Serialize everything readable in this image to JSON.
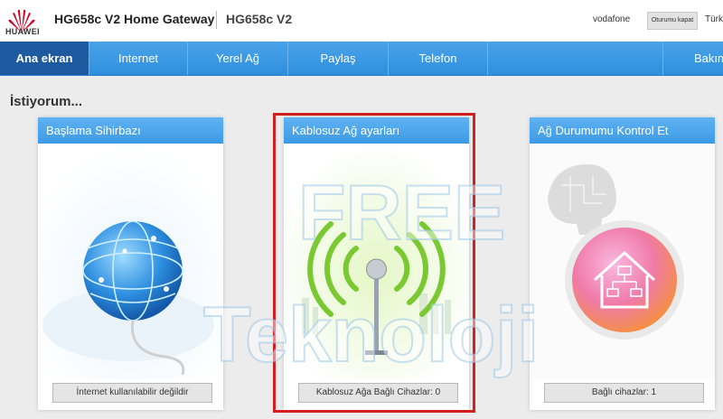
{
  "header": {
    "logo_text": "HUAWEI",
    "product_title": "HG658c V2 Home Gateway",
    "model": "HG658c V2",
    "user": "vodafone",
    "logout_label": "Oturumu kapat",
    "language": "Türkçe"
  },
  "nav": {
    "tabs": [
      {
        "label": "Ana ekran",
        "active": true
      },
      {
        "label": "Internet"
      },
      {
        "label": "Yerel Ağ"
      },
      {
        "label": "Paylaş"
      },
      {
        "label": "Telefon"
      },
      {
        "label": "Bakım"
      }
    ]
  },
  "main": {
    "heading": "İstiyorum...",
    "cards": [
      {
        "title": "Başlama Sihirbazı",
        "status": "İnternet kullanılabilir değildir",
        "icon": "globe-icon"
      },
      {
        "title": "Kablosuz Ağ ayarları",
        "status": "Kablosuz Ağa Bağlı Cihazlar: 0",
        "icon": "wifi-antenna-icon"
      },
      {
        "title": "Ağ Durumumu Kontrol Et",
        "status": "Bağlı cihazlar: 1",
        "icon": "home-network-icon"
      }
    ]
  },
  "watermark": {
    "line1": "FREE",
    "line2": "Teknoloji"
  },
  "colors": {
    "nav": "#3a98e3",
    "nav_active": "#1e5aa0",
    "highlight": "#d21f1f",
    "brand": "#cf0a2c"
  }
}
